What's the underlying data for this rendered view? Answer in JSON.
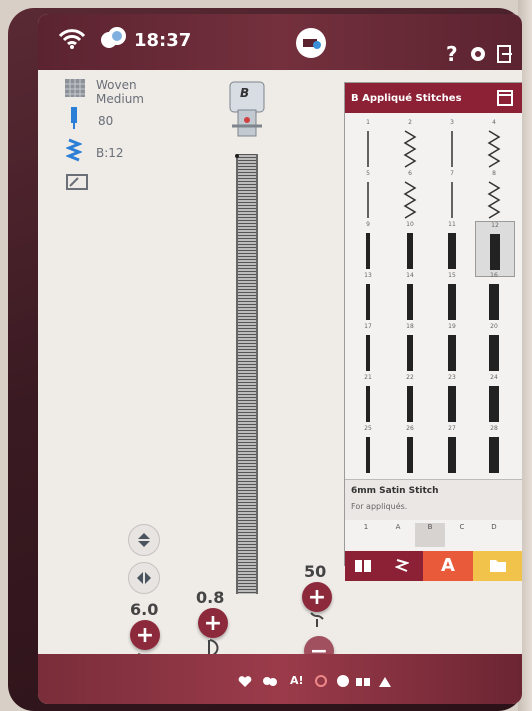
{
  "status": {
    "time": "18:37",
    "help_label": "?"
  },
  "fabric": {
    "type_line1": "Woven",
    "type_line2": "Medium",
    "needle": "80",
    "presser_foot": "B:12"
  },
  "presser_foot_label": "B",
  "stitch_panel": {
    "title": "B Appliqué Stitches",
    "stitch_numbers": [
      "1",
      "2",
      "3",
      "4",
      "5",
      "6",
      "7",
      "8",
      "9",
      "10",
      "11",
      "12",
      "13",
      "14",
      "15",
      "16",
      "17",
      "18",
      "19",
      "20",
      "21",
      "22",
      "23",
      "24",
      "25",
      "26",
      "27",
      "28"
    ],
    "selected": "12",
    "stitch_name": "6mm Satin Stitch",
    "stitch_desc": "For appliqués.",
    "category_tabs": [
      "1",
      "A",
      "B",
      "C",
      "D"
    ]
  },
  "controls": {
    "width_value": "6.0",
    "length_value": "0.8",
    "density_value": "50",
    "plus": "+",
    "minus": "−"
  },
  "tray_label": "A!",
  "colors": {
    "accent": "#8c2035",
    "tab_orange": "#e85a3a",
    "tab_yellow": "#f2c34a"
  }
}
